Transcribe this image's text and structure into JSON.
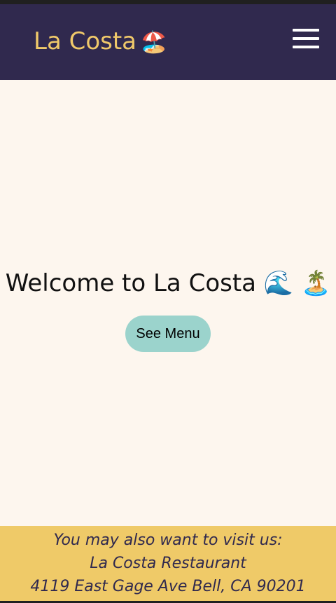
{
  "header": {
    "brand_name": "La Costa",
    "brand_emoji": "🏖️",
    "menu_icon": "hamburger-menu-icon"
  },
  "hero": {
    "title": "Welcome to La Costa 🌊 🏝️",
    "button_label": "See Menu"
  },
  "footer": {
    "line1": "You may also want to visit us:",
    "line2": "La Costa Restaurant",
    "line3": "4119 East Gage Ave Bell, CA 90201"
  },
  "colors": {
    "header_bg": "#30294e",
    "brand_text": "#f0c96a",
    "page_bg": "#fdf6ee",
    "button_bg": "#9bd3cc",
    "footer_bg": "#efca68",
    "footer_text": "#30294e"
  }
}
